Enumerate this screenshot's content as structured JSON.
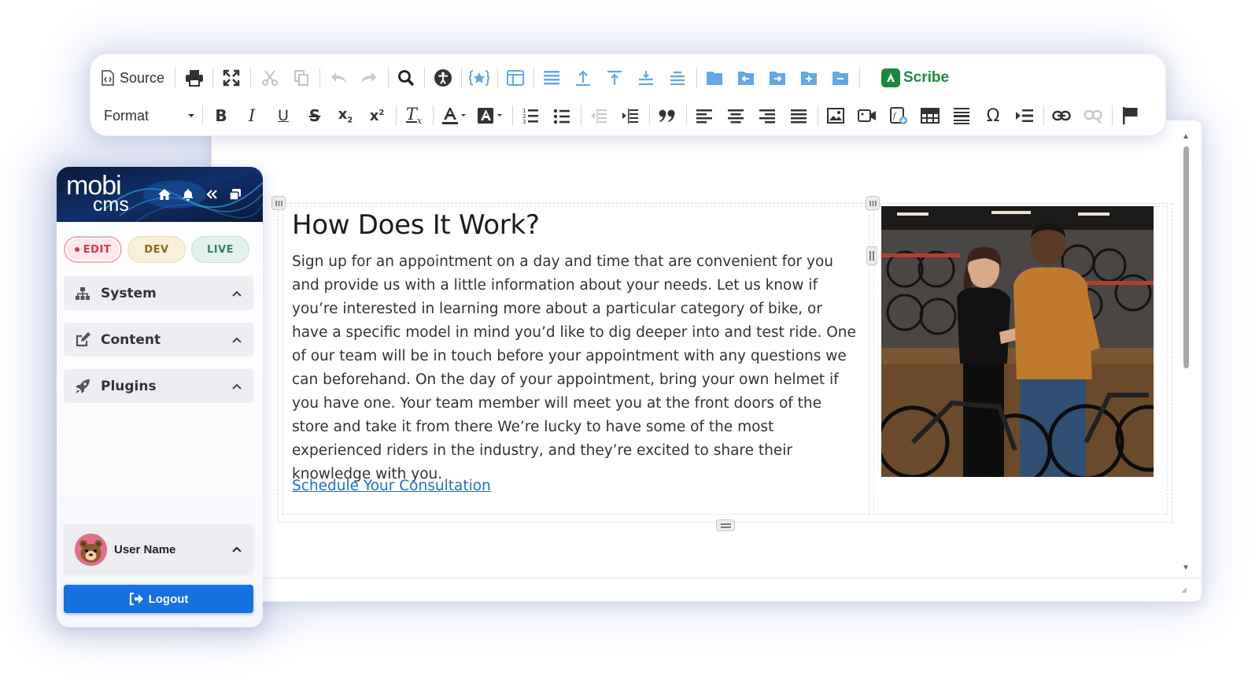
{
  "toolbar": {
    "source_label": "Source",
    "format_label": "Format",
    "scribe_label": "Scribe"
  },
  "sidebar": {
    "logo_line1": "mobi",
    "logo_line2": "cms",
    "modes": {
      "edit": "EDIT",
      "dev": "DEV",
      "live": "LIVE"
    },
    "sections": [
      {
        "label": "System",
        "icon": "sitemap-icon"
      },
      {
        "label": "Content",
        "icon": "edit-icon"
      },
      {
        "label": "Plugins",
        "icon": "rocket-icon"
      }
    ],
    "user_name": "User Name",
    "logout_label": "Logout"
  },
  "content": {
    "heading": "How Does It Work?",
    "paragraph": "Sign up for an appointment on a day and time that are convenient for you and provide us with a little information about your needs.  Let us know if you’re interested in learning more about a particular category of bike, or have a specific model in mind you’d like to dig deeper into and test ride. One of our team will be in touch before your appointment with any questions we can beforehand. On the day of your appointment, bring your own helmet if you have one. Your team member will meet you at the front doors of the store and take it from there We’re lucky to have some of the most experienced riders in the industry, and they’re excited to share their knowledge with you.",
    "link_text": "Schedule Your Consultation",
    "image_subject": "bike-shop-consultation-photo"
  },
  "colors": {
    "accent_blue": "#1672e0",
    "link_blue": "#1b6fd1",
    "scribe_green": "#1b8a3d",
    "edit_red": "#d23a4d",
    "toolbar_blue_icons": "#63a8e9"
  }
}
